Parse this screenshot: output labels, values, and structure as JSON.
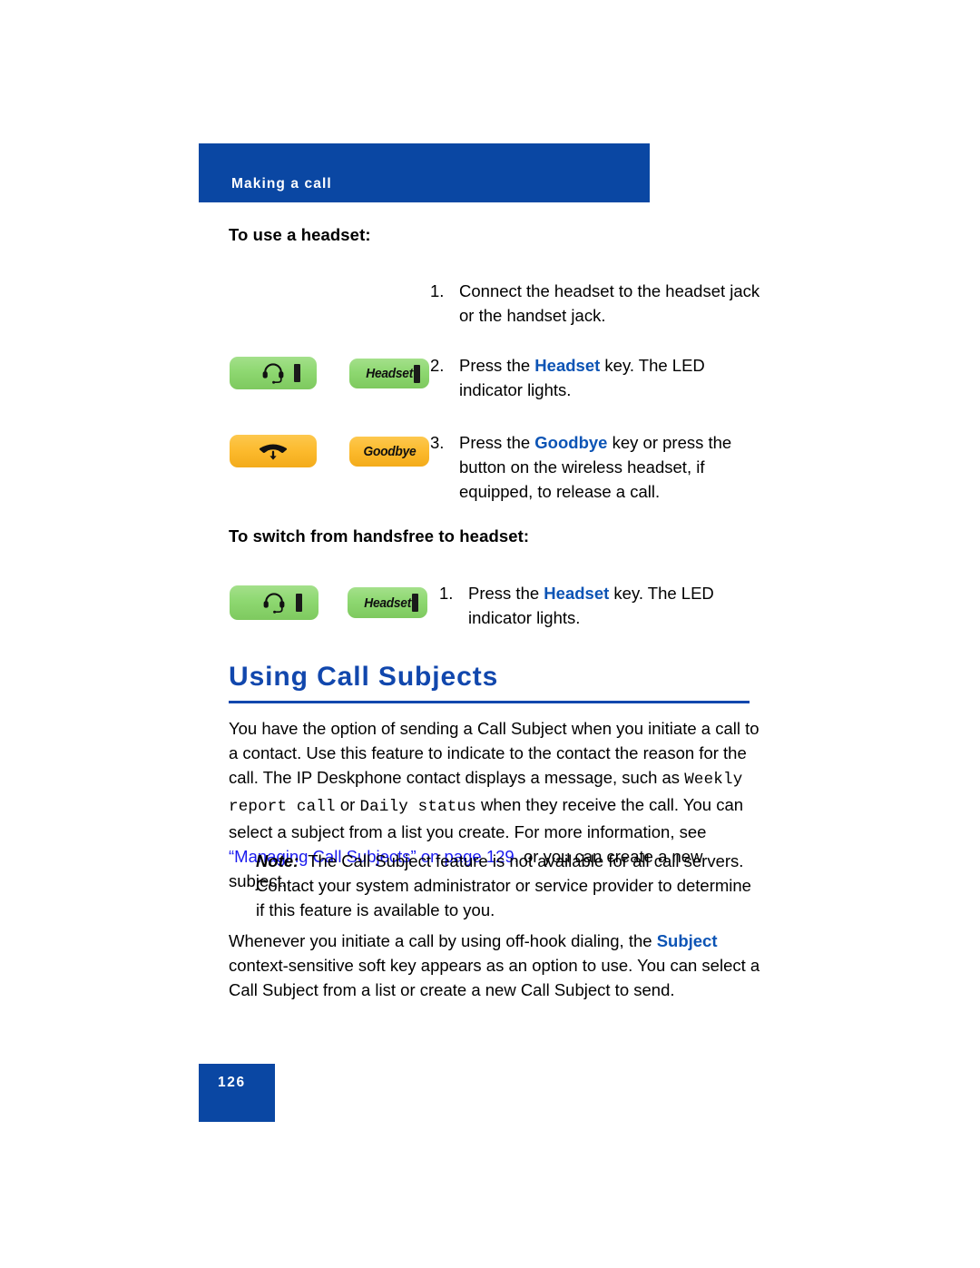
{
  "header": {
    "running_title": "Making a call",
    "bar_color": "#0a47a3"
  },
  "sections": [
    {
      "heading": "To use a headset:",
      "steps": [
        {
          "number": "1.",
          "parts": [
            {
              "text": "Connect the headset to the headset jack or the handset jack.",
              "style": "plain"
            }
          ]
        },
        {
          "number": "2.",
          "parts": [
            {
              "text": "Press the ",
              "style": "plain"
            },
            {
              "text": "Headset",
              "style": "keyword"
            },
            {
              "text": " key. The LED indicator lights.",
              "style": "plain"
            }
          ]
        },
        {
          "number": "3.",
          "parts": [
            {
              "text": "Press the ",
              "style": "plain"
            },
            {
              "text": "Goodbye",
              "style": "keyword"
            },
            {
              "text": " key or press the button on the wireless headset, if equipped, to release a call.",
              "style": "plain"
            }
          ]
        }
      ]
    },
    {
      "heading": "To switch from handsfree to headset:",
      "steps": [
        {
          "number": "1.",
          "parts": [
            {
              "text": "Press the ",
              "style": "plain"
            },
            {
              "text": "Headset",
              "style": "keyword"
            },
            {
              "text": " key. The LED indicator lights.",
              "style": "plain"
            }
          ]
        }
      ]
    }
  ],
  "keys": {
    "headset_icon": {
      "icon": "headset-icon",
      "color": "#8fd873",
      "led": true
    },
    "headset_text": {
      "label": "Headset",
      "color": "#8fd873",
      "led": true
    },
    "goodbye_icon": {
      "icon": "goodbye-handset-icon",
      "color": "#fcbb2f",
      "led": false
    },
    "goodbye_text": {
      "label": "Goodbye",
      "color": "#fcbb2f",
      "led": false
    }
  },
  "main_section": {
    "title": "Using Call Subjects",
    "title_color": "#1147ad",
    "intro_paragraph": {
      "segments": [
        {
          "text": "You have the option of sending a Call Subject when you initiate a call to a contact. Use this feature to indicate to the contact the reason for the call. The IP Deskphone contact displays a message, such as ",
          "style": "plain"
        },
        {
          "text": "Weekly report call",
          "style": "mono"
        },
        {
          "text": " or ",
          "style": "plain"
        },
        {
          "text": "Daily status",
          "style": "mono"
        },
        {
          "text": " when they receive the call. You can select a subject from a list you create. For more information, see ",
          "style": "plain"
        },
        {
          "text": "“Managing Call Subjects” on page 129",
          "style": "link"
        },
        {
          "text": ", or you can create a new subject.",
          "style": "plain"
        }
      ]
    },
    "note": {
      "label": "Note:",
      "text": "The Call Subject feature is not available for all call servers. Contact your system administrator or service provider to determine if this feature is available to you."
    },
    "closing_paragraph": {
      "segments": [
        {
          "text": "Whenever you initiate a call by using off-hook dialing, the ",
          "style": "plain"
        },
        {
          "text": "Subject",
          "style": "keyword"
        },
        {
          "text": " context-sensitive soft key appears as an option to use. You can select a Call Subject from a list or create a new Call Subject to send.",
          "style": "plain"
        }
      ]
    }
  },
  "footer": {
    "page_number": "126",
    "box_color": "#0a47a3"
  }
}
